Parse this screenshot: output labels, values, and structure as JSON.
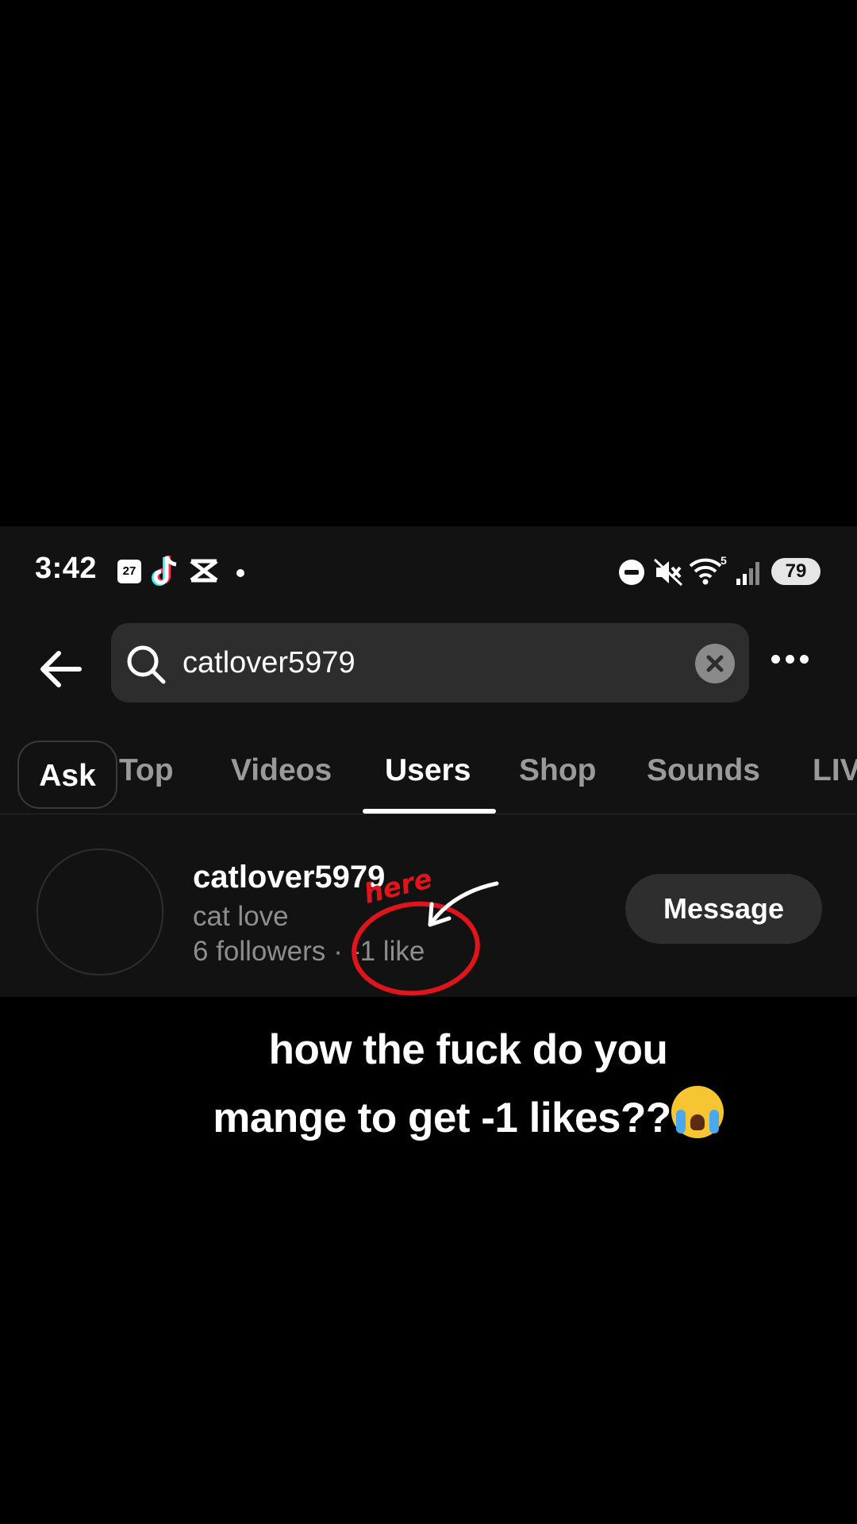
{
  "status_bar": {
    "time": "3:42",
    "calendar_day": "27",
    "battery": "79",
    "icons": [
      "calendar-icon",
      "tiktok-icon",
      "capcut-icon",
      "dot-icon",
      "dnd-icon",
      "mute-icon",
      "wifi-icon",
      "signal-icon"
    ]
  },
  "search": {
    "query": "catlover5979",
    "icons": [
      "back-arrow-icon",
      "search-icon",
      "clear-icon",
      "more-icon"
    ]
  },
  "tabs": [
    {
      "label": "Ask"
    },
    {
      "label": "Top"
    },
    {
      "label": "Videos"
    },
    {
      "label": "Users",
      "active": true
    },
    {
      "label": "Shop"
    },
    {
      "label": "Sounds"
    },
    {
      "label": "LIV"
    }
  ],
  "user": {
    "username": "catlover5979",
    "nickname": "cat love",
    "followers": "6 followers",
    "separator": "·",
    "likes": "-1 like",
    "message_label": "Message"
  },
  "annotation": {
    "label": "here",
    "color": "#e0141b"
  },
  "caption": {
    "line1": "how the fuck do you",
    "line2": "mange to get -1 likes??",
    "emoji": "loudly-crying-face-emoji"
  }
}
